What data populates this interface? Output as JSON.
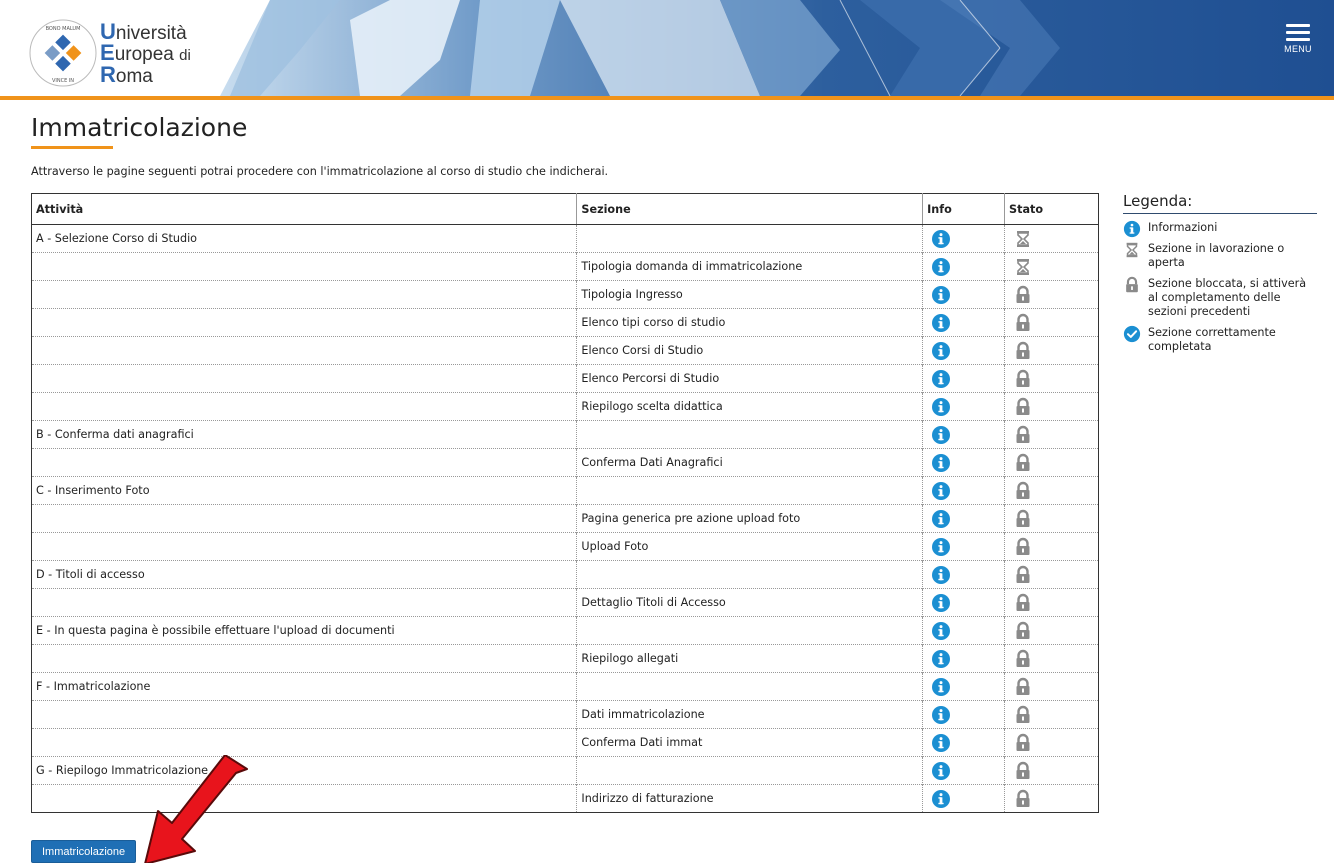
{
  "header": {
    "logo_seal_text": "BONO MALUM · VINCE IN",
    "logo_line1_cap": "U",
    "logo_line1_rest": "niversità",
    "logo_line2_cap": "E",
    "logo_line2_rest": "uropea",
    "logo_line2_suffix": "di",
    "logo_line3_cap": "R",
    "logo_line3_rest": "oma",
    "menu_label": "MENU"
  },
  "page": {
    "title": "Immatricolazione",
    "intro": "Attraverso le pagine seguenti potrai procedere con l'immatricolazione al corso di studio che indicherai."
  },
  "table": {
    "headers": {
      "attivita": "Attività",
      "sezione": "Sezione",
      "info": "Info",
      "stato": "Stato"
    },
    "rows": [
      {
        "attivita": "A - Selezione Corso di Studio",
        "sezione": "",
        "stato_icon": "hourglass-icon"
      },
      {
        "attivita": "",
        "sezione": "Tipologia domanda di immatricolazione",
        "stato_icon": "hourglass-icon"
      },
      {
        "attivita": "",
        "sezione": "Tipologia Ingresso",
        "stato_icon": "lock-icon"
      },
      {
        "attivita": "",
        "sezione": "Elenco tipi corso di studio",
        "stato_icon": "lock-icon"
      },
      {
        "attivita": "",
        "sezione": "Elenco Corsi di Studio",
        "stato_icon": "lock-icon"
      },
      {
        "attivita": "",
        "sezione": "Elenco Percorsi di Studio",
        "stato_icon": "lock-icon"
      },
      {
        "attivita": "",
        "sezione": "Riepilogo scelta didattica",
        "stato_icon": "lock-icon"
      },
      {
        "attivita": "B - Conferma dati anagrafici",
        "sezione": "",
        "stato_icon": "lock-icon"
      },
      {
        "attivita": "",
        "sezione": "Conferma Dati Anagrafici",
        "stato_icon": "lock-icon"
      },
      {
        "attivita": "C - Inserimento Foto",
        "sezione": "",
        "stato_icon": "lock-icon"
      },
      {
        "attivita": "",
        "sezione": "Pagina generica pre azione upload foto",
        "stato_icon": "lock-icon"
      },
      {
        "attivita": "",
        "sezione": "Upload Foto",
        "stato_icon": "lock-icon"
      },
      {
        "attivita": "D - Titoli di accesso",
        "sezione": "",
        "stato_icon": "lock-icon"
      },
      {
        "attivita": "",
        "sezione": "Dettaglio Titoli di Accesso",
        "stato_icon": "lock-icon"
      },
      {
        "attivita": "E - In questa pagina è possibile effettuare l'upload di documenti",
        "sezione": "",
        "stato_icon": "lock-icon"
      },
      {
        "attivita": "",
        "sezione": "Riepilogo allegati",
        "stato_icon": "lock-icon"
      },
      {
        "attivita": "F - Immatricolazione",
        "sezione": "",
        "stato_icon": "lock-icon"
      },
      {
        "attivita": "",
        "sezione": "Dati immatricolazione",
        "stato_icon": "lock-icon"
      },
      {
        "attivita": "",
        "sezione": "Conferma Dati immat",
        "stato_icon": "lock-icon"
      },
      {
        "attivita": "G - Riepilogo Immatricolazione",
        "sezione": "",
        "stato_icon": "lock-icon"
      },
      {
        "attivita": "",
        "sezione": "Indirizzo di fatturazione",
        "stato_icon": "lock-icon"
      }
    ]
  },
  "legend": {
    "title": "Legenda:",
    "items": [
      {
        "icon": "info-icon",
        "label": "Informazioni"
      },
      {
        "icon": "hourglass-icon",
        "label": "Sezione in lavorazione o aperta"
      },
      {
        "icon": "lock-icon",
        "label": "Sezione bloccata, si attiverà al completamento delle sezioni precedenti"
      },
      {
        "icon": "check-icon",
        "label": "Sezione correttamente completata"
      }
    ]
  },
  "actions": {
    "immatricolazione_label": "Immatricolazione"
  },
  "colors": {
    "accent_orange": "#f0931a",
    "info_blue": "#1b8fd2",
    "button_blue": "#1f6fb5",
    "icon_grey": "#8a8a8a",
    "arrow_red": "#e8141c"
  }
}
